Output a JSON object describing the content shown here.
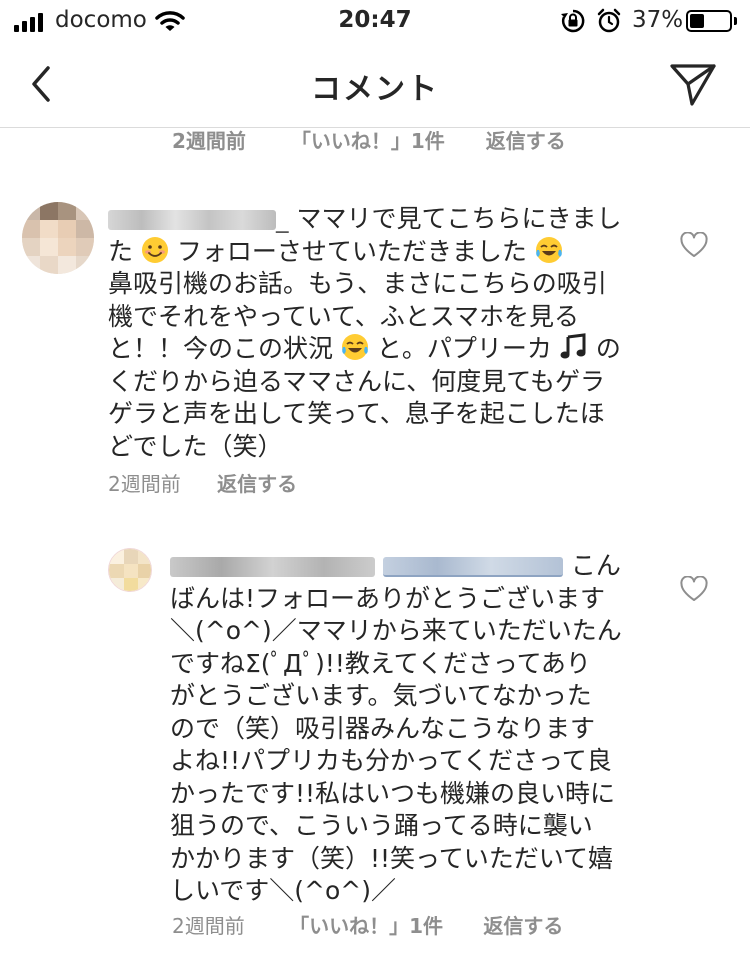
{
  "status_bar": {
    "carrier": "docomo",
    "time": "20:47",
    "battery_percent": "37%",
    "battery_level": 0.37
  },
  "header": {
    "title": "コメント"
  },
  "top_meta": {
    "time": "2週間前",
    "likes": "「いいね！」1件",
    "reply": "返信する"
  },
  "comments": [
    {
      "text_lines": [
        "ママリで見てこちらにきまし",
        "た",
        "フォローさせていただきました",
        "鼻吸引機のお話。もう、まさにこちらの吸引",
        "機でそれをやっていて、ふとスマホを見る",
        "と！！今のこの状況",
        "と。パプリーカ",
        "の",
        "くだりから迫るママさんに、何度見てもゲラ",
        "ゲラと声を出して笑って、息子を起こしたほ",
        "どでした（笑）"
      ],
      "meta": {
        "time": "2週間前",
        "reply": "返信する"
      }
    },
    {
      "text_lines": [
        "こん",
        "ばんは!フォローありがとうございます",
        "＼(^o^)／ママリから来ていただいたん",
        "ですねΣ(ﾟДﾟ)!!教えてくださってあり",
        "がとうございます。気づいてなかった",
        "ので（笑）吸引器みんなこうなります",
        "よね!!パプリカも分かってくださって良",
        "かったです!!私はいつも機嫌の良い時に",
        "狙うので、こういう踊ってる時に襲い",
        "かかります（笑）!!笑っていただいて嬉",
        "しいです＼(^o^)／"
      ],
      "meta": {
        "time": "2週間前",
        "likes": "「いいね！」1件",
        "reply": "返信する"
      }
    }
  ],
  "colors": {
    "text": "#262626",
    "meta": "#8e8e8e",
    "divider": "#dbdbdb",
    "mention": "#a9b9cf"
  }
}
